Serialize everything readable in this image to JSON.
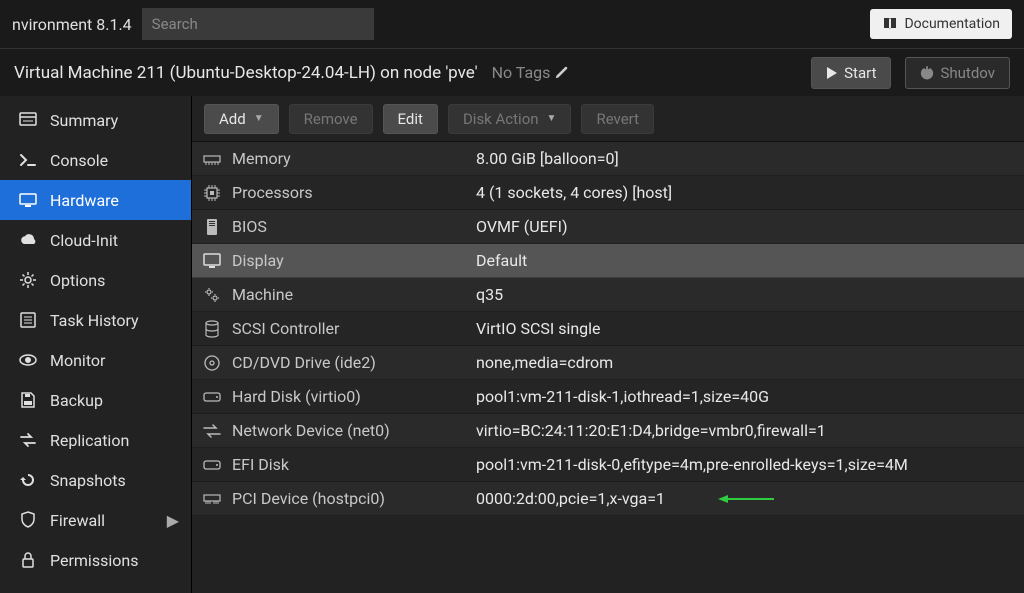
{
  "topbar": {
    "version_label": "nvironment 8.1.4",
    "search_placeholder": "Search",
    "documentation_label": "Documentation"
  },
  "titlebar": {
    "vm_title": "Virtual Machine 211 (Ubuntu-Desktop-24.04-LH) on node 'pve'",
    "no_tags": "No Tags",
    "start_label": "Start",
    "shutdown_label": "Shutdov"
  },
  "sidebar": {
    "items": [
      {
        "key": "summary",
        "label": "Summary"
      },
      {
        "key": "console",
        "label": "Console"
      },
      {
        "key": "hardware",
        "label": "Hardware"
      },
      {
        "key": "cloudinit",
        "label": "Cloud-Init"
      },
      {
        "key": "options",
        "label": "Options"
      },
      {
        "key": "taskhistory",
        "label": "Task History"
      },
      {
        "key": "monitor",
        "label": "Monitor"
      },
      {
        "key": "backup",
        "label": "Backup"
      },
      {
        "key": "replication",
        "label": "Replication"
      },
      {
        "key": "snapshots",
        "label": "Snapshots"
      },
      {
        "key": "firewall",
        "label": "Firewall"
      },
      {
        "key": "permissions",
        "label": "Permissions"
      }
    ],
    "active_key": "hardware"
  },
  "toolbar": {
    "add_label": "Add",
    "remove_label": "Remove",
    "edit_label": "Edit",
    "disk_action_label": "Disk Action",
    "revert_label": "Revert"
  },
  "hardware_rows": [
    {
      "icon": "memory",
      "label": "Memory",
      "value": "8.00 GiB [balloon=0]"
    },
    {
      "icon": "cpu",
      "label": "Processors",
      "value": "4 (1 sockets, 4 cores) [host]"
    },
    {
      "icon": "bios",
      "label": "BIOS",
      "value": "OVMF (UEFI)"
    },
    {
      "icon": "display",
      "label": "Display",
      "value": "Default",
      "selected": true
    },
    {
      "icon": "gears",
      "label": "Machine",
      "value": "q35"
    },
    {
      "icon": "db",
      "label": "SCSI Controller",
      "value": "VirtIO SCSI single"
    },
    {
      "icon": "disc",
      "label": "CD/DVD Drive (ide2)",
      "value": "none,media=cdrom"
    },
    {
      "icon": "hdd",
      "label": "Hard Disk (virtio0)",
      "value": "pool1:vm-211-disk-1,iothread=1,size=40G"
    },
    {
      "icon": "net",
      "label": "Network Device (net0)",
      "value": "virtio=BC:24:11:20:E1:D4,bridge=vmbr0,firewall=1"
    },
    {
      "icon": "hdd",
      "label": "EFI Disk",
      "value": "pool1:vm-211-disk-0,efitype=4m,pre-enrolled-keys=1,size=4M"
    },
    {
      "icon": "pci",
      "label": "PCI Device (hostpci0)",
      "value": "0000:2d:00,pcie=1,x-vga=1",
      "arrow": true
    }
  ]
}
